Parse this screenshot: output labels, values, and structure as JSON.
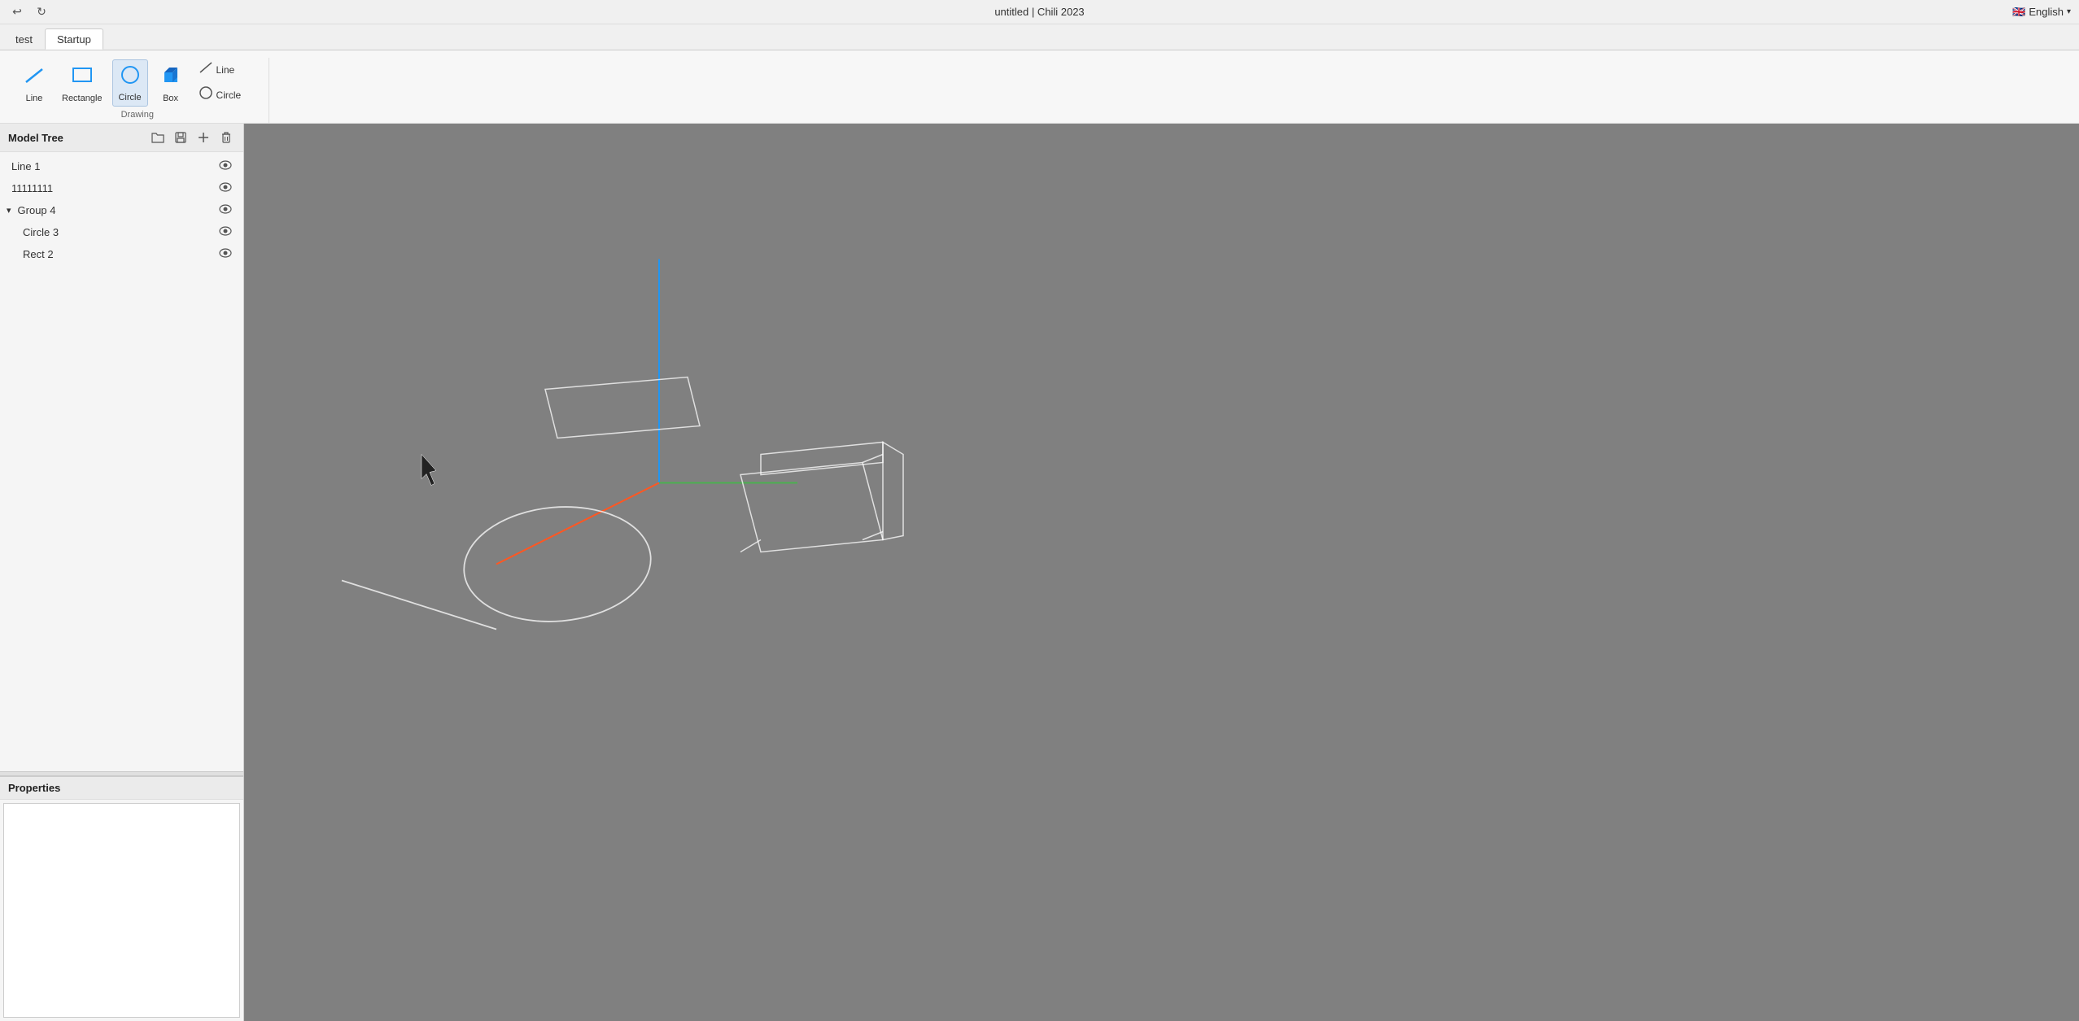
{
  "titlebar": {
    "title": "untitled | Chili 2023",
    "undo_label": "↩",
    "redo_label": "↻",
    "language": "English",
    "lang_flag": "🇬🇧"
  },
  "tabs": [
    {
      "id": "test",
      "label": "test",
      "active": false
    },
    {
      "id": "startup",
      "label": "Startup",
      "active": true
    }
  ],
  "ribbon": {
    "groups": [
      {
        "id": "drawing",
        "label": "Drawing",
        "tools_row1": [
          {
            "id": "line",
            "label": "Line",
            "icon": "line"
          },
          {
            "id": "rectangle",
            "label": "Rectangle",
            "icon": "rect"
          },
          {
            "id": "circle",
            "label": "Circle",
            "icon": "circle",
            "active": true
          },
          {
            "id": "box",
            "label": "Box",
            "icon": "box3d"
          }
        ],
        "tools_row2": [
          {
            "id": "line2",
            "label": "Line",
            "icon": "line-small"
          },
          {
            "id": "circle2",
            "label": "Circle",
            "icon": "circle-small"
          }
        ]
      }
    ]
  },
  "model_tree": {
    "title": "Model Tree",
    "actions": [
      {
        "id": "open-folder",
        "icon": "📁",
        "tooltip": "Open folder"
      },
      {
        "id": "save",
        "icon": "💾",
        "tooltip": "Save"
      },
      {
        "id": "add",
        "icon": "➕",
        "tooltip": "Add"
      },
      {
        "id": "delete",
        "icon": "🗑",
        "tooltip": "Delete"
      }
    ],
    "items": [
      {
        "id": "line1",
        "label": "Line 1",
        "type": "item",
        "indent": 0,
        "visible": true
      },
      {
        "id": "11111111",
        "label": "11111111",
        "type": "item",
        "indent": 0,
        "visible": true
      },
      {
        "id": "group4",
        "label": "Group 4",
        "type": "group",
        "indent": 0,
        "visible": true,
        "expanded": true
      },
      {
        "id": "circle3",
        "label": "Circle 3",
        "type": "item",
        "indent": 1,
        "visible": true
      },
      {
        "id": "rect2",
        "label": "Rect 2",
        "type": "item",
        "indent": 1,
        "visible": true
      }
    ]
  },
  "properties": {
    "title": "Properties"
  },
  "viewport": {
    "background": "#808080"
  },
  "status_bar": {
    "text": ""
  }
}
